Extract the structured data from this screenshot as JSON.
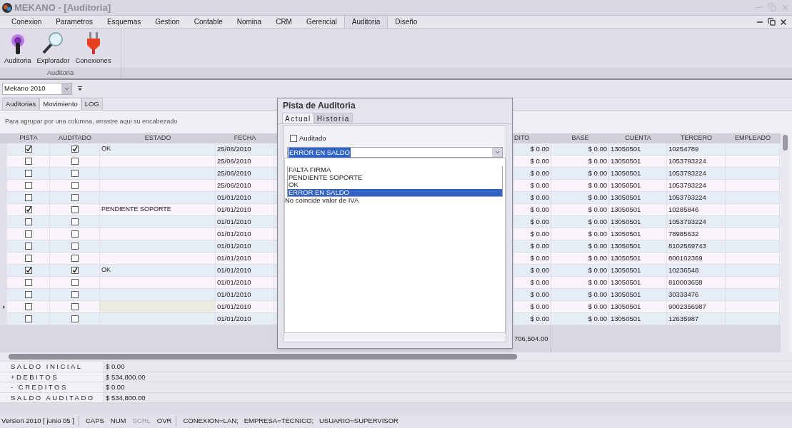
{
  "window": {
    "title": "MEKANO - [Auditoria]"
  },
  "menu_tabs": [
    {
      "label": "Conexion",
      "selected": false
    },
    {
      "label": "Parametros",
      "selected": false
    },
    {
      "label": "Esquemas",
      "selected": false
    },
    {
      "label": "Gestion",
      "selected": false
    },
    {
      "label": "Contable",
      "selected": false
    },
    {
      "label": "Nomina",
      "selected": false
    },
    {
      "label": "CRM",
      "selected": false
    },
    {
      "label": "Gerencial",
      "selected": false
    },
    {
      "label": "Auditoria",
      "selected": true
    },
    {
      "label": "Diseño",
      "selected": false
    }
  ],
  "ribbon": {
    "group": "Auditoria",
    "buttons": [
      {
        "kind": "broadcast",
        "label": "Auditoria"
      },
      {
        "kind": "magnifier",
        "label": "Explorador"
      },
      {
        "kind": "plug",
        "label": "Conexiones"
      }
    ]
  },
  "company_select": {
    "value": "Mekano 2010"
  },
  "view_tabs": [
    {
      "label": "Auditorias",
      "selected": false
    },
    {
      "label": "Movimiento",
      "selected": true
    },
    {
      "label": "LOG",
      "selected": false
    }
  ],
  "group_hint": "Para agrupar por una columna, arrastre aqui su encabezado",
  "table": {
    "columns": [
      "PISTA",
      "AUDITADO",
      "ESTADO",
      "FECHA",
      "DITO",
      "BASE",
      "CUENTA",
      "TERCERO",
      "EMPLEADO"
    ],
    "rows": [
      {
        "pista": true,
        "auditado": true,
        "estado": "OK",
        "fecha": "25/06/2010",
        "credito": "$ 0.00",
        "base": "$ 0.00",
        "cuenta": "13050501",
        "tercero": "10254789",
        "selected": false
      },
      {
        "pista": false,
        "auditado": false,
        "fecha": "25/06/2010",
        "credito": "$ 0.00",
        "base": "$ 0.00",
        "cuenta": "13050501",
        "tercero": "1053793224",
        "selected": false
      },
      {
        "pista": false,
        "auditado": false,
        "fecha": "25/06/2010",
        "credito": "$ 0.00",
        "base": "$ 0.00",
        "cuenta": "13050501",
        "tercero": "1053793224",
        "selected": false
      },
      {
        "pista": false,
        "auditado": false,
        "fecha": "25/06/2010",
        "credito": "$ 0.00",
        "base": "$ 0.00",
        "cuenta": "13050501",
        "tercero": "1053793224",
        "selected": false
      },
      {
        "pista": false,
        "auditado": false,
        "fecha": "01/01/2010",
        "credito": "$ 0.00",
        "base": "$ 0.00",
        "cuenta": "13050501",
        "tercero": "1053793224",
        "selected": false
      },
      {
        "pista": true,
        "auditado": false,
        "estado": "PENDIENTE SOPORTE",
        "fecha": "01/01/2010",
        "credito": "$ 0.00",
        "base": "$ 0.00",
        "cuenta": "13050501",
        "tercero": "10285846",
        "selected": false
      },
      {
        "pista": false,
        "auditado": false,
        "fecha": "01/01/2010",
        "credito": "$ 0.00",
        "base": "$ 0.00",
        "cuenta": "13050501",
        "tercero": "1053793224",
        "selected": false
      },
      {
        "pista": false,
        "auditado": false,
        "fecha": "01/01/2010",
        "credito": "$ 0.00",
        "base": "$ 0.00",
        "cuenta": "13050501",
        "tercero": "78985632",
        "selected": false
      },
      {
        "pista": false,
        "auditado": false,
        "fecha": "01/01/2010",
        "credito": "$ 0.00",
        "base": "$ 0.00",
        "cuenta": "13050501",
        "tercero": "8102569743",
        "selected": false
      },
      {
        "pista": false,
        "auditado": false,
        "fecha": "01/01/2010",
        "credito": "$ 0.00",
        "base": "$ 0.00",
        "cuenta": "13050501",
        "tercero": "800102369",
        "selected": false
      },
      {
        "pista": true,
        "auditado": true,
        "estado": "OK",
        "fecha": "01/01/2010",
        "credito": "$ 0.00",
        "base": "$ 0.00",
        "cuenta": "13050501",
        "tercero": "10236548",
        "selected": false
      },
      {
        "pista": false,
        "auditado": false,
        "fecha": "01/01/2010",
        "credito": "$ 0.00",
        "base": "$ 0.00",
        "cuenta": "13050501",
        "tercero": "810003658",
        "selected": false
      },
      {
        "pista": false,
        "auditado": false,
        "fecha": "01/01/2010",
        "credito": "$ 0.00",
        "base": "$ 0.00",
        "cuenta": "13050501",
        "tercero": "30333476",
        "selected": false
      },
      {
        "pista": false,
        "auditado": false,
        "fecha": "01/01/2010",
        "credito": "$ 0.00",
        "base": "$ 0.00",
        "cuenta": "13050501",
        "tercero": "9002356987",
        "selected": true
      },
      {
        "pista": false,
        "auditado": false,
        "fecha": "01/01/2010",
        "credito": "$ 0.00",
        "base": "$ 0.00",
        "cuenta": "13050501",
        "tercero": "12635987",
        "selected": false
      }
    ],
    "footer_total": "706,504.00"
  },
  "summary": [
    {
      "label": "SALDO INICIAL",
      "value": "$ 0.00"
    },
    {
      "label": "+DEBITOS",
      "value": "$ 534,800.00"
    },
    {
      "label": "- CREDITOS",
      "value": "$ 0.00"
    },
    {
      "label": "SALDO AUDITADO",
      "value": "$ 534,800.00"
    }
  ],
  "dialog": {
    "title": "Pista de Auditoria",
    "tabs": [
      {
        "label": "Actual",
        "selected": true
      },
      {
        "label": "Historia",
        "selected": false
      }
    ],
    "auditado": {
      "label": "Auditado",
      "checked": false
    },
    "estado_combo": {
      "value": "ERROR EN SALDO"
    },
    "options": [
      {
        "label": "FALTA FIRMA",
        "selected": false
      },
      {
        "label": "PENDIENTE SOPORTE",
        "selected": false
      },
      {
        "label": "OK",
        "selected": false
      },
      {
        "label": "ERROR EN SALDO",
        "selected": true
      }
    ],
    "note": "No coincide valor de IVA"
  },
  "status_bar": [
    {
      "label": "Version 2010 [ junio 05 ]",
      "disabled": false
    },
    {
      "label": "CAPS",
      "disabled": false
    },
    {
      "label": "NUM",
      "disabled": false
    },
    {
      "label": "SCRL",
      "disabled": true
    },
    {
      "label": "OVR",
      "disabled": false
    },
    {
      "label": "CONEXION=LAN;   EMPRESA=TECNICO;   USUARIO=SUPERVISOR",
      "disabled": false
    }
  ]
}
